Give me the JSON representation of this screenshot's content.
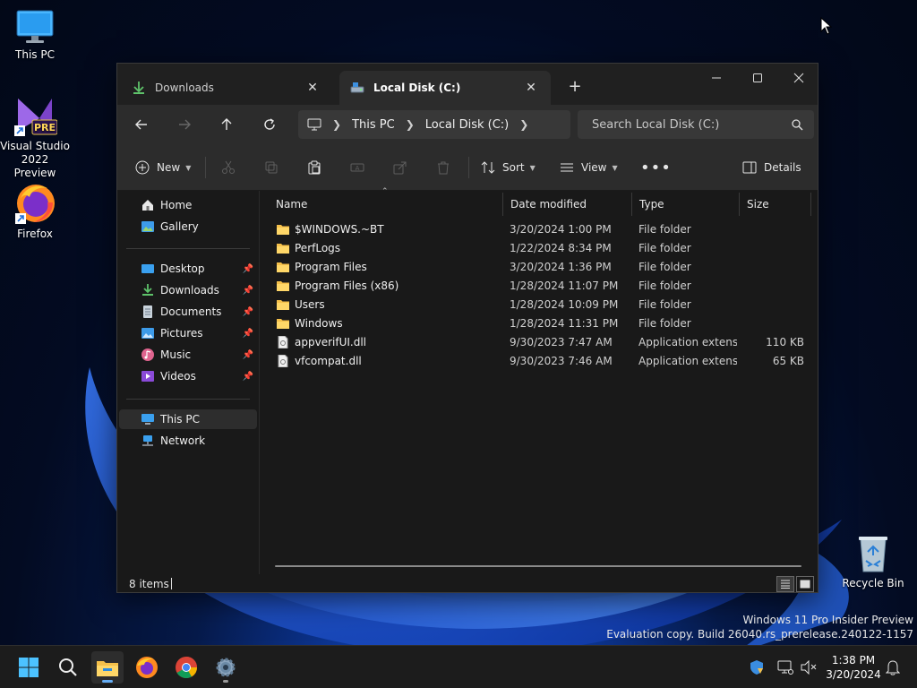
{
  "desktop": {
    "icons": [
      {
        "label": "This PC",
        "icon": "monitor-icon"
      },
      {
        "label": "Visual Studio 2022 Preview",
        "badge": "PRE",
        "icon": "visual-studio-icon"
      },
      {
        "label": "Firefox",
        "icon": "firefox-icon"
      },
      {
        "label": "Recycle Bin",
        "icon": "recycle-bin-icon"
      }
    ],
    "watermark": {
      "line1": "Windows 11 Pro Insider Preview",
      "line2": "Evaluation copy. Build 26040.rs_prerelease.240122-1157"
    }
  },
  "explorer": {
    "tabs": [
      {
        "label": "Downloads",
        "icon": "download-icon",
        "active": false
      },
      {
        "label": "Local Disk (C:)",
        "icon": "drive-icon",
        "active": true
      }
    ],
    "breadcrumb": [
      "This PC",
      "Local Disk (C:)"
    ],
    "search": {
      "placeholder": "Search Local Disk (C:)"
    },
    "commands": {
      "new_label": "New",
      "sort_label": "Sort",
      "view_label": "View",
      "details_label": "Details"
    },
    "nav": {
      "top": [
        {
          "label": "Home",
          "icon": "home-icon"
        },
        {
          "label": "Gallery",
          "icon": "gallery-icon"
        }
      ],
      "quick": [
        {
          "label": "Desktop",
          "icon": "desktop-icon",
          "pinned": true
        },
        {
          "label": "Downloads",
          "icon": "download-icon",
          "pinned": true
        },
        {
          "label": "Documents",
          "icon": "documents-icon",
          "pinned": true
        },
        {
          "label": "Pictures",
          "icon": "pictures-icon",
          "pinned": true
        },
        {
          "label": "Music",
          "icon": "music-icon",
          "pinned": true
        },
        {
          "label": "Videos",
          "icon": "videos-icon",
          "pinned": true
        }
      ],
      "bottom": [
        {
          "label": "This PC",
          "icon": "this-pc-icon",
          "selected": true
        },
        {
          "label": "Network",
          "icon": "network-icon"
        }
      ]
    },
    "columns": {
      "name": "Name",
      "date": "Date modified",
      "type": "Type",
      "size": "Size"
    },
    "files": [
      {
        "name": "$WINDOWS.~BT",
        "date": "3/20/2024 1:00 PM",
        "type": "File folder",
        "size": "",
        "kind": "folder"
      },
      {
        "name": "PerfLogs",
        "date": "1/22/2024 8:34 PM",
        "type": "File folder",
        "size": "",
        "kind": "folder"
      },
      {
        "name": "Program Files",
        "date": "3/20/2024 1:36 PM",
        "type": "File folder",
        "size": "",
        "kind": "folder"
      },
      {
        "name": "Program Files (x86)",
        "date": "1/28/2024 11:07 PM",
        "type": "File folder",
        "size": "",
        "kind": "folder"
      },
      {
        "name": "Users",
        "date": "1/28/2024 10:09 PM",
        "type": "File folder",
        "size": "",
        "kind": "folder"
      },
      {
        "name": "Windows",
        "date": "1/28/2024 11:31 PM",
        "type": "File folder",
        "size": "",
        "kind": "folder"
      },
      {
        "name": "appverifUI.dll",
        "date": "9/30/2023 7:47 AM",
        "type": "Application extens...",
        "size": "110 KB",
        "kind": "file"
      },
      {
        "name": "vfcompat.dll",
        "date": "9/30/2023 7:46 AM",
        "type": "Application extens...",
        "size": "65 KB",
        "kind": "file"
      }
    ],
    "status": {
      "count": "8 items"
    }
  },
  "taskbar": {
    "clock_time": "1:38 PM",
    "clock_date": "3/20/2024"
  },
  "colors": {
    "folder": "#f5c04a",
    "accent": "#66aef5"
  }
}
